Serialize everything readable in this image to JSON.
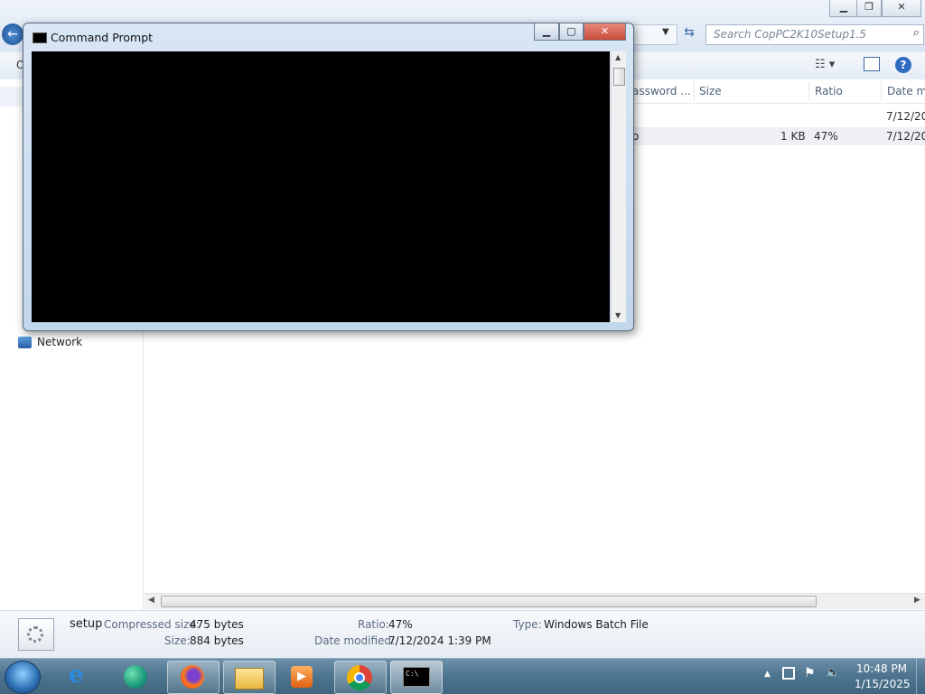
{
  "explorer": {
    "search_placeholder": "Search CopPC2K10Setup1.5",
    "toolbar_org": "O",
    "columns": {
      "password": "assword ...",
      "size": "Size",
      "ratio": "Ratio",
      "date": "Date mo"
    },
    "rows": [
      {
        "name": "",
        "size": "",
        "ratio": "",
        "date": "7/12/20"
      },
      {
        "name": "o",
        "size": "1 KB",
        "ratio": "47%",
        "date": "7/12/20"
      }
    ],
    "nav": {
      "network": "Network"
    },
    "status": {
      "filename": "setup",
      "compressed_label": "Compressed size:",
      "compressed_value": "475 bytes",
      "size_label": "Size:",
      "size_value": "884 bytes",
      "ratio_label": "Ratio:",
      "ratio_value": "47%",
      "modified_label": "Date modified:",
      "modified_value": "7/12/2024 1:39 PM",
      "type_label": "Type:",
      "type_value": "Windows Batch File"
    }
  },
  "cmd": {
    "title": "Command Prompt",
    "icon_text": "C:\\"
  },
  "taskbar": {
    "apps": [
      "start-orb",
      "internet-explorer",
      "edge",
      "firefox",
      "file-explorer",
      "media-player",
      "chrome",
      "command-prompt"
    ],
    "time": "10:48 PM",
    "date": "1/15/2025"
  },
  "colors": {
    "accent": "#3f6680",
    "cmd_bg": "#000000",
    "close": "#c94a3a"
  }
}
